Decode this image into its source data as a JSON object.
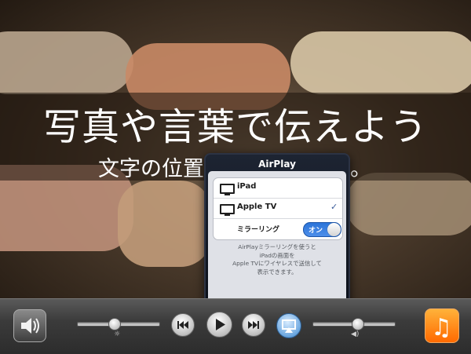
{
  "background": {
    "headline": "写真や言葉で伝えよう",
    "subline_left": "文字の位置",
    "subline_right": "。"
  },
  "airplay_popover": {
    "title": "AirPlay",
    "devices": [
      {
        "label": "iPad",
        "icon": "tv-icon",
        "selected": false
      },
      {
        "label": "Apple TV",
        "icon": "tv-icon",
        "selected": true
      }
    ],
    "checkmark": "✓",
    "mirroring": {
      "label": "ミラーリング",
      "state_label": "オン",
      "on": true
    },
    "note": "AirPlayミラーリングを使うと\niPadの画面を\nApple TVにワイヤレスで送信して\n表示できます。"
  },
  "bottom_bar": {
    "left_app_icon": "speaker-icon",
    "brightness": {
      "icon": "sun-icon",
      "icon_glyph": "☼",
      "level": 0.45
    },
    "controls": [
      "rewind-icon",
      "play-icon",
      "fast-forward-icon",
      "airplay-icon"
    ],
    "volume": {
      "icon": "speaker-small-icon",
      "icon_glyph": "◀)",
      "level": 0.55
    },
    "right_app_icon": "music-note-icon",
    "music_glyph": "♫"
  }
}
